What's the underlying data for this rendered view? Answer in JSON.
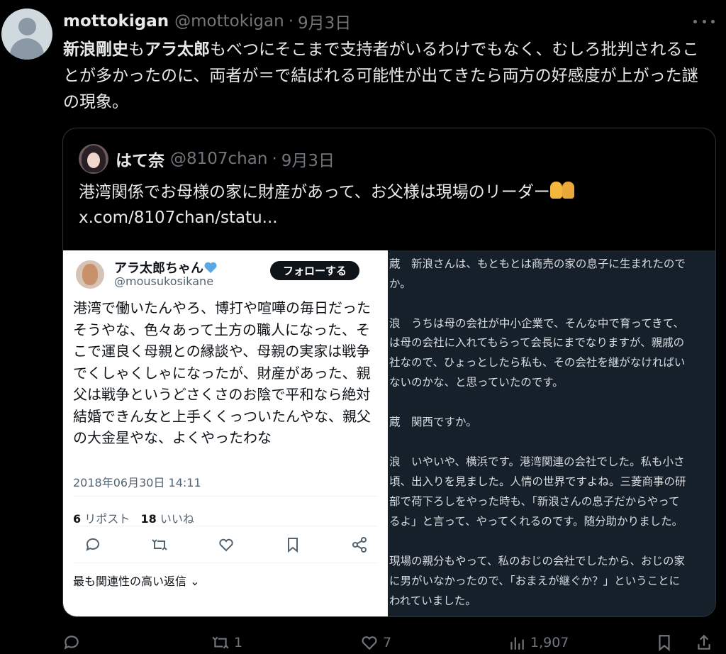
{
  "tweet": {
    "author_name": "mottokigan",
    "author_handle": "@mottokigan",
    "dot": "·",
    "date": "9月3日",
    "text_parts": [
      "新浪剛史",
      "も",
      "アラ太郎",
      "もべつにそこまで支持者がいるわけでもなく、むしろ批判されることが多かったのに、両者が＝で結ばれる可能性が出てきたら両方の好感度が上がった謎の現象。"
    ]
  },
  "quote": {
    "author_name": "はて奈",
    "author_handle": "@8107chan",
    "dot": "·",
    "date": "9月3日",
    "text": "港湾関係でお母様の家に財産があって、お父様は現場のリーダー",
    "link": "x.com/8107chan/statu..."
  },
  "card": {
    "name": "アラ太郎ちゃん",
    "handle": "@mousukosikane",
    "follow_label": "フォローする",
    "body": "港湾で働いたんやろ、博打や喧嘩の毎日だったそうやな、色々あって土方の職人になった、そこで運良く母親との縁談や、母親の実家は戦争でくしゃくしゃになったが、財産があった、親父は戦争というどさくさのお陰で平和なら絶対結婚できん女と上手くくっついたんやな、親父の大金星やな、よくやったわな",
    "date": "2018年06月30日 14:11",
    "reposts_count": "6",
    "reposts_label": "リポスト",
    "likes_count": "18",
    "likes_label": "いいね",
    "replies_label": "最も関連性の高い返信"
  },
  "panel_lines": [
    "蔵　新浪さんは、もともとは商売の家の息子に生まれたので",
    "か。",
    "",
    "浪　うちは母の会社が中小企業で、そんな中で育ってきて、",
    "は母の会社に入れてもらって会長にまでなりますが、親戚の",
    "社なので、ひょっとしたら私も、その会社を継がなければい",
    "ないのかな、と思っていたのです。",
    "",
    "蔵　関西ですか。",
    "",
    "浪　いやいや、横浜です。港湾関連の会社でした。私も小さ",
    "頃、出入りを見ました。人情の世界ですよね。三菱商事の研",
    "部で荷下ろしをやった時も、「新浪さんの息子だからやって",
    "るよ」と言って、やってくれるのです。随分助かりました。",
    "",
    "現場の親分もやって、私のおじの会社でしたから、おじの家",
    "に男がいなかったので、「おまえが継ぐか？」ということに",
    "われていました。"
  ],
  "actions": {
    "reply_count": "",
    "retweet_count": "1",
    "like_count": "7",
    "views_count": "1,907"
  }
}
